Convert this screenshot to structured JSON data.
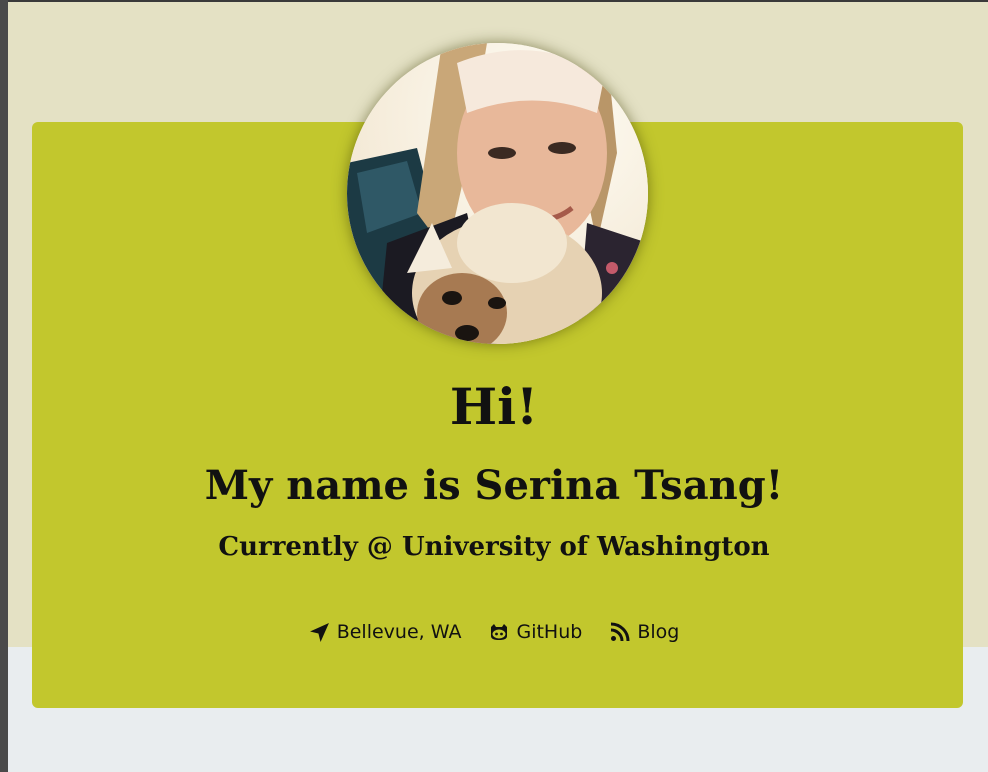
{
  "profile": {
    "greeting": "Hi!",
    "name_line": "My name is Serina Tsang!",
    "current_line": "Currently @ University of Washington"
  },
  "links": [
    {
      "label": "Bellevue, WA",
      "icon": "location-arrow-icon"
    },
    {
      "label": "GitHub",
      "icon": "github-icon"
    },
    {
      "label": "Blog",
      "icon": "rss-icon"
    }
  ],
  "colors": {
    "hero_band": "#e4e1c4",
    "card": "#c2c72d",
    "page_background": "#e9edef",
    "text": "#111111"
  }
}
